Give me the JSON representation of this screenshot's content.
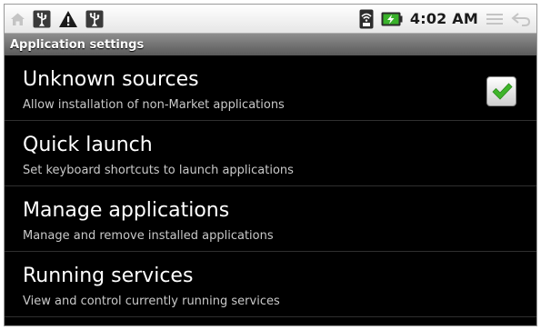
{
  "status_bar": {
    "time": "4:02 AM",
    "left_icons": [
      "home-icon",
      "usb-icon",
      "warning-icon",
      "usb-icon"
    ],
    "right_icons": [
      "signal-icon",
      "battery-charging-icon",
      "menu-icon",
      "back-icon"
    ]
  },
  "title": "Application settings",
  "settings": [
    {
      "title": "Unknown sources",
      "summary": "Allow installation of non-Market applications",
      "checked": true
    },
    {
      "title": "Quick launch",
      "summary": "Set keyboard shortcuts to launch applications"
    },
    {
      "title": "Manage applications",
      "summary": "Manage and remove installed applications"
    },
    {
      "title": "Running services",
      "summary": "View and control currently running services"
    }
  ],
  "colors": {
    "background": "#000000",
    "check_green": "#3fb52a",
    "title_bar": "#6e6e6e"
  }
}
